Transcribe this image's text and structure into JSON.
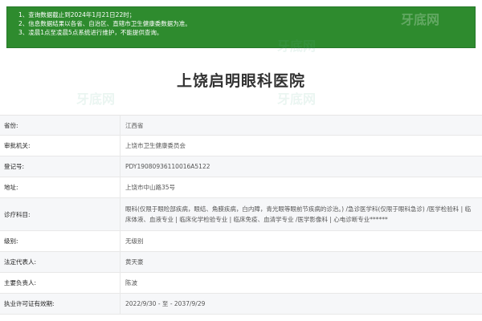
{
  "notice": {
    "lines": [
      "1、查询数据截止到2024年1月21日22时；",
      "2、信息数据结果以各省、自治区、直辖市卫生健康委数据为准。",
      "3、凌晨1点至凌晨5点系统进行维护，不能提供查询。"
    ]
  },
  "watermark": "牙底网",
  "hospital": {
    "name": "上饶启明眼科医院"
  },
  "fields": [
    {
      "label": "省份:",
      "value": "江西省"
    },
    {
      "label": "审批机关:",
      "value": "上饶市卫生健康委员会"
    },
    {
      "label": "登记号:",
      "value": "PDY19080936110016A5122"
    },
    {
      "label": "地址:",
      "value": "上饶市中山路35号"
    },
    {
      "label": "诊疗科目:",
      "value": "眼科(仅限于眼睑部疾病，眼结、角膜疾病，白内障，青光眼等眼前节疾病的诊治。) /急诊医学科(仅限于眼科急诊) /医学检验科 | 临床体液、血液专业 | 临床化学检验专业 | 临床免疫、血清学专业 /医学影像科 | 心电诊断专业******"
    },
    {
      "label": "级别:",
      "value": "无级别"
    },
    {
      "label": "法定代表人:",
      "value": "黄天豪"
    },
    {
      "label": "主要负责人:",
      "value": "陈波"
    },
    {
      "label": "执业许可证有效期:",
      "value": "2022/9/30 - 至 - 2037/9/29"
    }
  ]
}
